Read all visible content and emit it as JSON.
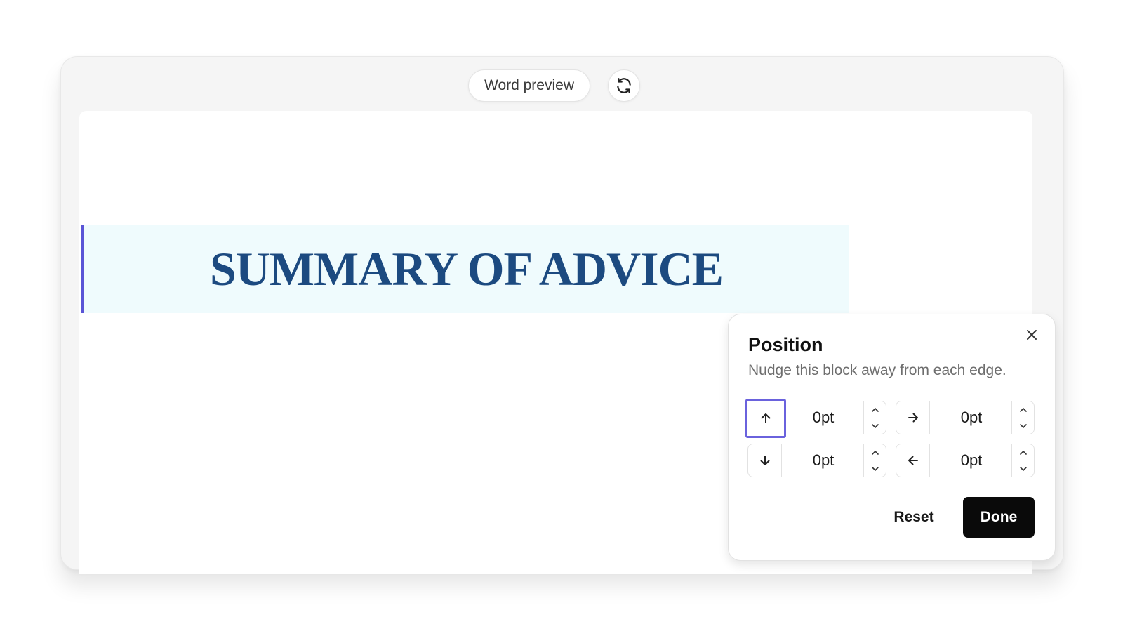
{
  "toolbar": {
    "preview_label": "Word preview",
    "refresh_icon": "refresh-icon"
  },
  "document": {
    "heading": "SUMMARY OF ADVICE"
  },
  "position_panel": {
    "title": "Position",
    "subtitle": "Nudge this block away from each edge.",
    "close_icon": "close-icon",
    "fields": [
      {
        "direction": "top",
        "icon": "arrow-up-icon",
        "value": "0pt"
      },
      {
        "direction": "right",
        "icon": "arrow-right-icon",
        "value": "0pt"
      },
      {
        "direction": "bottom",
        "icon": "arrow-down-icon",
        "value": "0pt"
      },
      {
        "direction": "left",
        "icon": "arrow-left-icon",
        "value": "0pt"
      }
    ],
    "reset_label": "Reset",
    "done_label": "Done"
  },
  "colors": {
    "heading": "#1c4a80",
    "block_bg": "#effbfd",
    "block_accent": "#5a55d6",
    "focus_ring": "#6a62dd",
    "primary_button": "#0a0a0a"
  }
}
